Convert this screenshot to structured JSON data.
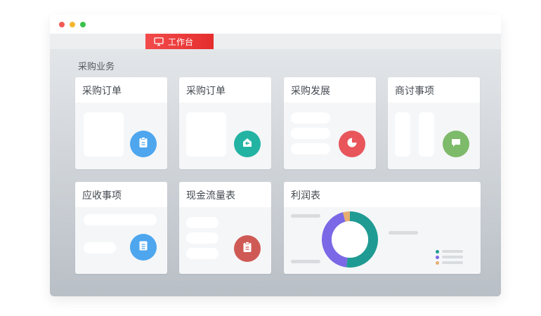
{
  "window": {
    "tab": {
      "label": "工作台",
      "icon": "monitor-icon",
      "color": "#ef3b3b"
    }
  },
  "section": {
    "title": "采购业务"
  },
  "cards": [
    {
      "title": "采购订单",
      "badge_icon": "clipboard-icon",
      "badge_color": "#4ea6ee"
    },
    {
      "title": "采购订单",
      "badge_icon": "home-arrow-icon",
      "badge_color": "#22b3a3"
    },
    {
      "title": "采购发展",
      "badge_icon": "pie-chart-icon",
      "badge_color": "#e8555b"
    },
    {
      "title": "商讨事项",
      "badge_icon": "chat-icon",
      "badge_color": "#7dba6a"
    },
    {
      "title": "应收事项",
      "badge_icon": "document-icon",
      "badge_color": "#4ea6ee"
    },
    {
      "title": "现金流量表",
      "badge_icon": "clipboard-icon",
      "badge_color": "#cf5a55"
    },
    {
      "title": "利润表"
    }
  ],
  "chart_data": {
    "type": "pie",
    "variant": "donut",
    "values": [
      52,
      44,
      4
    ],
    "colors": [
      "#1f9b93",
      "#7a68e6",
      "#e6ae70"
    ],
    "legend": {
      "placement": "bottom-right",
      "colors": [
        "#1f9b93",
        "#7a68e6",
        "#e6ae70"
      ]
    }
  }
}
